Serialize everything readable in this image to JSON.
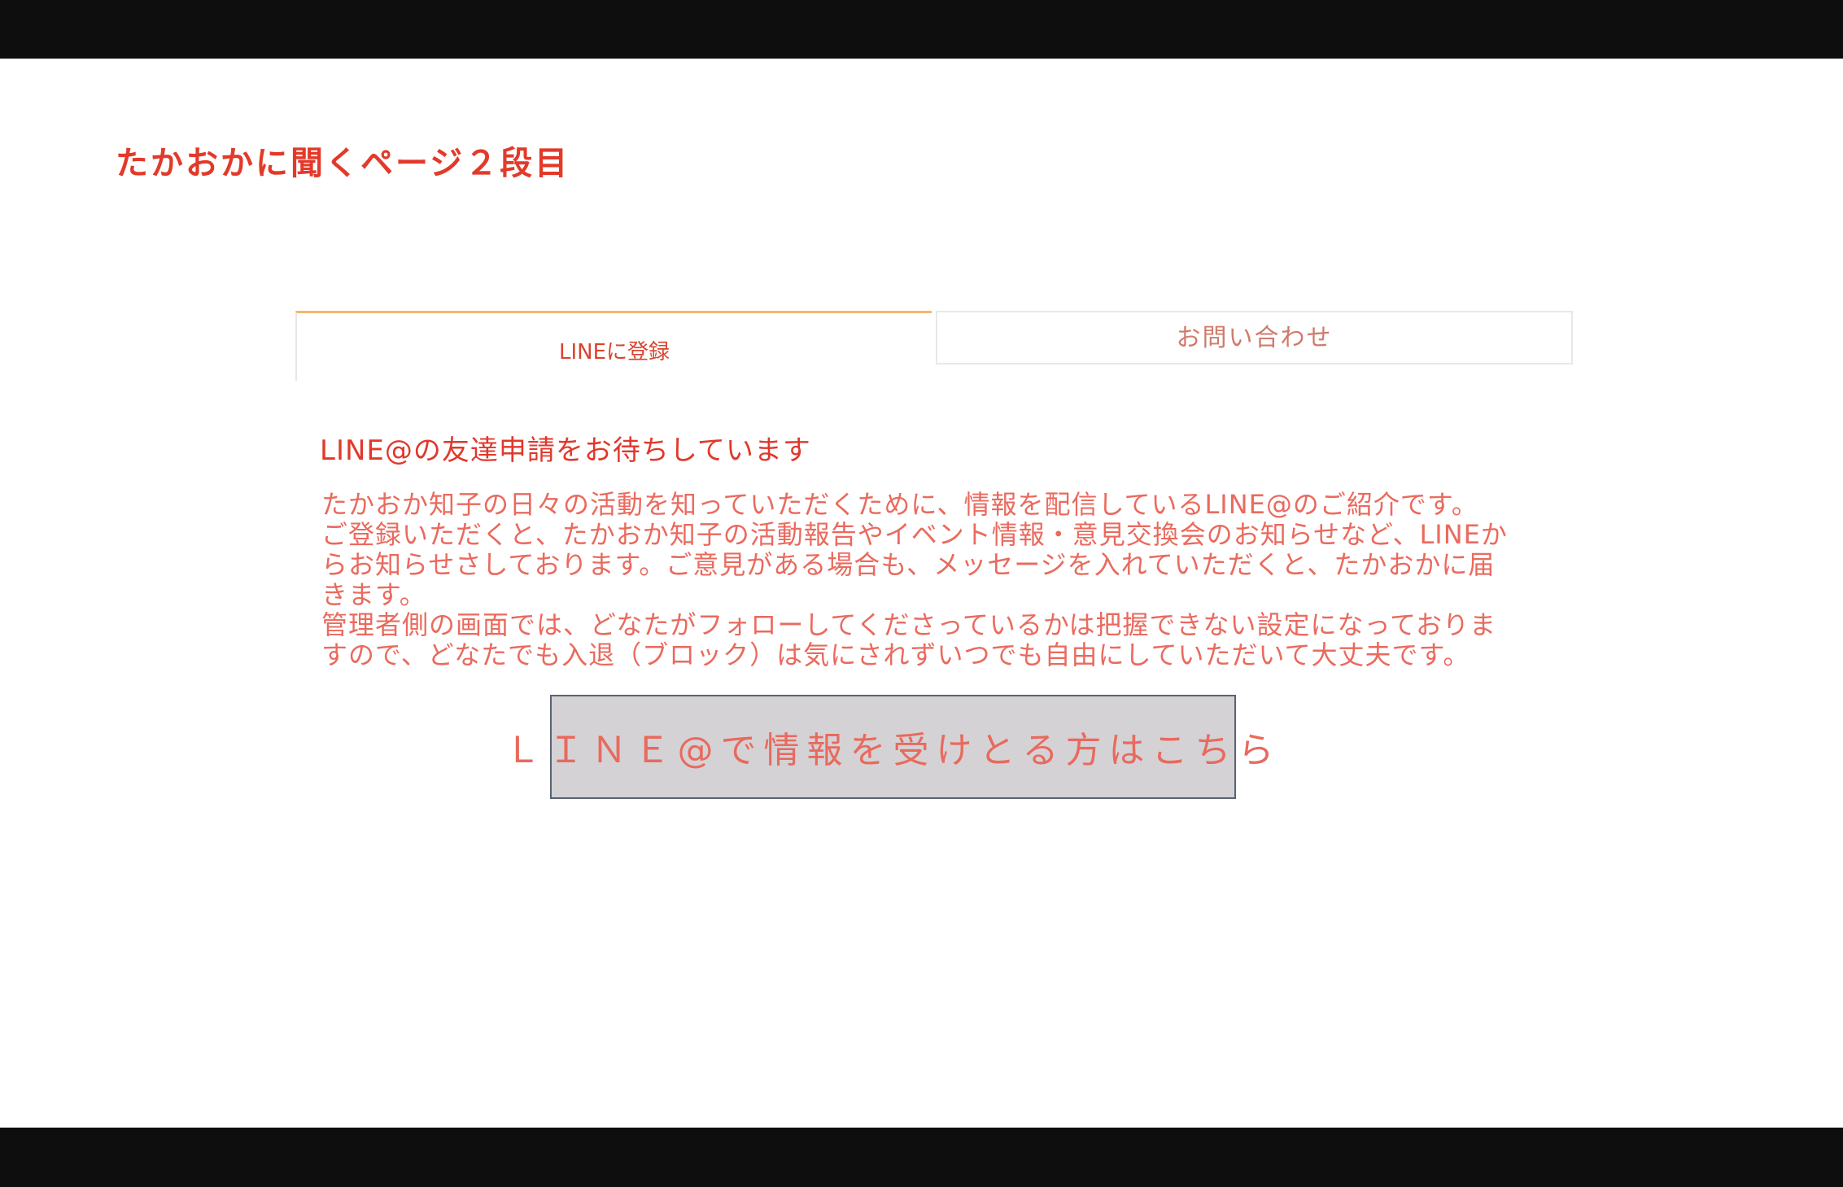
{
  "page": {
    "title": "たかおかに聞くページ２段目"
  },
  "tabs": [
    {
      "label": "LINEに登録",
      "active": true
    },
    {
      "label": "お問い合わせ",
      "active": false
    }
  ],
  "content": {
    "heading": "LINE@の友達申請をお待ちしています",
    "lines": [
      "たかおか知子の日々の活動を知っていただくために、情報を配信しているLINE@のご紹介です。",
      "ご登録いただくと、たかおか知子の活動報告やイベント情報・意見交換会のお知らせなど、LINEか",
      "らお知らせさしております。ご意見がある場合も、メッセージを入れていただくと、たかおかに届",
      "きます。",
      "管理者側の画面では、どなたがフォローしてくださっているかは把握できない設定になっておりま",
      "すので、どなたでも入退（ブロック）は気にされずいつでも自由にしていただいて大丈夫です。"
    ],
    "button_label": "ＬＩＮＥ@で情報を受けとる方はこちら"
  },
  "colors": {
    "accent_red": "#e0382b",
    "tab_active_border": "#f7b46e",
    "button_bg": "#d5d2d5",
    "letterbox": "#0e0e0e"
  }
}
